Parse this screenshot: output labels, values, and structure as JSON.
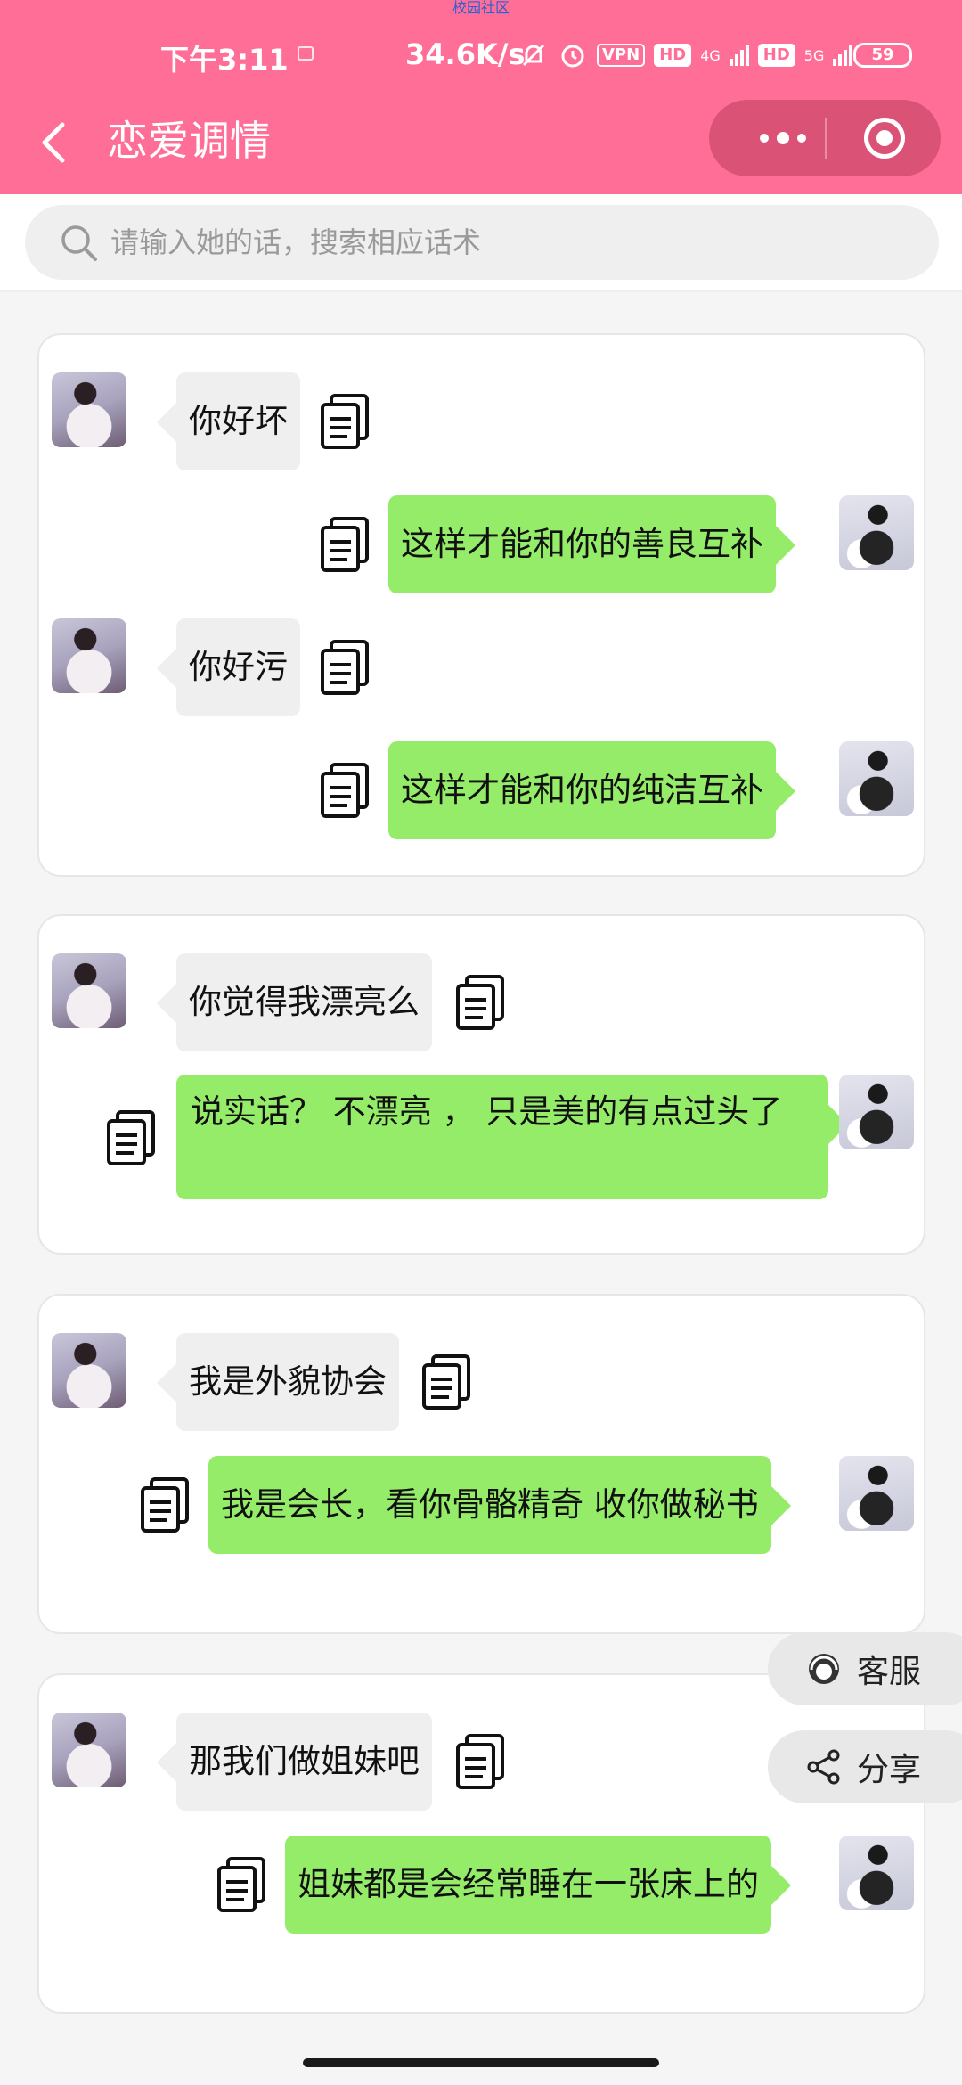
{
  "status_bar": {
    "tiny_label": "校园社区",
    "time": "下午3:11",
    "speed": "34.6K/s",
    "vpn": "VPN",
    "hd1": "HD",
    "net1": "4G",
    "hd2": "HD",
    "net2": "5G",
    "battery": "59"
  },
  "header": {
    "title": "恋爱调情"
  },
  "search": {
    "placeholder": "请输入她的话，搜索相应话术"
  },
  "cards": [
    {
      "messages": [
        {
          "from": "her",
          "text": "你好坏"
        },
        {
          "from": "him",
          "text": "这样才能和你的善良互补"
        },
        {
          "from": "her",
          "text": "你好污"
        },
        {
          "from": "him",
          "text": "这样才能和你的纯洁互补"
        }
      ]
    },
    {
      "messages": [
        {
          "from": "her",
          "text": "你觉得我漂亮么"
        },
        {
          "from": "him",
          "text": "说实话？ 不漂亮 ， 只是美的有点过头了"
        }
      ]
    },
    {
      "messages": [
        {
          "from": "her",
          "text": "我是外貌协会"
        },
        {
          "from": "him",
          "text": "我是会长，看你骨骼精奇 收你做秘书"
        }
      ]
    },
    {
      "messages": [
        {
          "from": "her",
          "text": "那我们做姐妹吧"
        },
        {
          "from": "him",
          "text": "姐妹都是会经常睡在一张床上的"
        }
      ]
    }
  ],
  "float_buttons": {
    "service": "客服",
    "share": "分享"
  },
  "colors": {
    "header": "#ff6e96",
    "bubble_her": "#efefef",
    "bubble_him": "#95ec69"
  }
}
